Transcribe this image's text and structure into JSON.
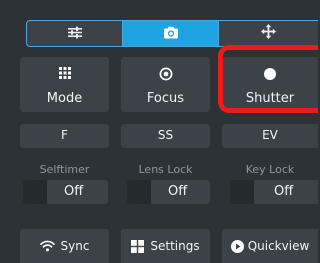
{
  "tabs": [
    {
      "icon": "sliders-icon",
      "active": false
    },
    {
      "icon": "camera-icon",
      "active": true
    },
    {
      "icon": "move-arrows-icon",
      "active": false
    }
  ],
  "mode_buttons": [
    {
      "label": "Mode",
      "icon": "grid-icon"
    },
    {
      "label": "Focus",
      "icon": "target-icon"
    },
    {
      "label": "Shutter",
      "icon": "record-dot-icon",
      "highlighted": true
    }
  ],
  "settings_buttons": [
    "F",
    "SS",
    "EV"
  ],
  "toggles": [
    {
      "caption": "Selftimer",
      "state": "Off"
    },
    {
      "caption": "Lens Lock",
      "state": "Off"
    },
    {
      "caption": "Key Lock",
      "state": "Off"
    }
  ],
  "actions": [
    {
      "label": "Sync",
      "icon": "wifi-icon"
    },
    {
      "label": "Settings",
      "icon": "grid-2x2-icon"
    },
    {
      "label": "Quickview",
      "icon": "play-circle-icon"
    }
  ],
  "colors": {
    "background": "#2c3236",
    "tile": "#3b4348",
    "accent": "#1fa4e3",
    "highlight": "#ec1c1c",
    "caption": "#8e989e"
  }
}
